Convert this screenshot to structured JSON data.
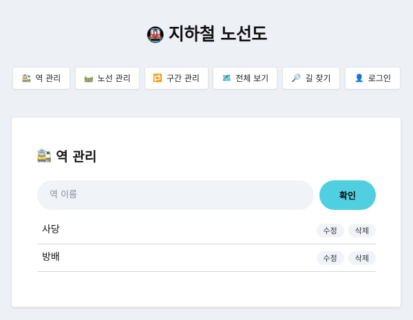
{
  "app": {
    "title": "지하철 노선도",
    "title_icon": "🚇"
  },
  "nav": [
    {
      "icon": "🚉",
      "label": "역 관리"
    },
    {
      "icon": "🛤️",
      "label": "노선 관리"
    },
    {
      "icon": "🔁",
      "label": "구간 관리"
    },
    {
      "icon": "🗺️",
      "label": "전체 보기"
    },
    {
      "icon": "🔎",
      "label": "길 찾기"
    },
    {
      "icon": "👤",
      "label": "로그인"
    }
  ],
  "station_page": {
    "icon": "🚉",
    "title": "역 관리",
    "input_placeholder": "역 이름",
    "input_value": "",
    "confirm_label": "확인",
    "stations": [
      {
        "name": "사당",
        "edit_label": "수정",
        "delete_label": "삭제"
      },
      {
        "name": "방배",
        "edit_label": "수정",
        "delete_label": "삭제"
      }
    ]
  }
}
